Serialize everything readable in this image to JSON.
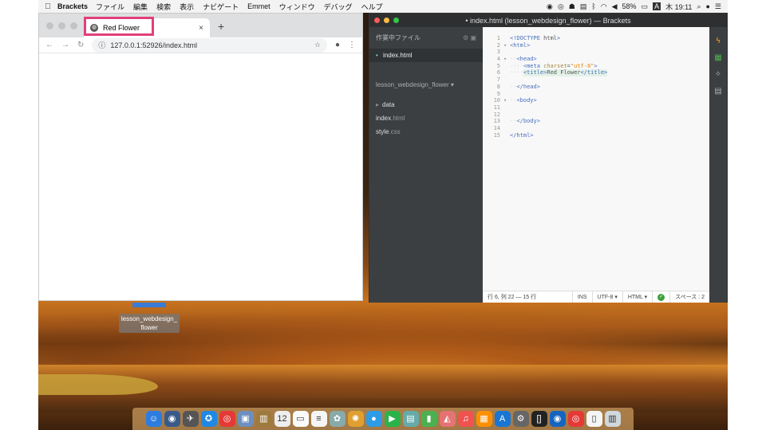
{
  "menubar": {
    "apple": "",
    "app_name": "Brackets",
    "menus": [
      "ファイル",
      "編集",
      "検索",
      "表示",
      "ナビゲート",
      "Emmet",
      "ウィンドウ",
      "デバッグ",
      "ヘルプ"
    ],
    "battery": "58%",
    "clock": "木 19:11"
  },
  "chrome": {
    "tab_title": "Red Flower",
    "url": "127.0.0.1:52926/index.html",
    "new_tab": "+",
    "close_tab": "×"
  },
  "desktop": {
    "folder_label": "lesson_webdesign_\nflower"
  },
  "brackets": {
    "window_title": "• index.html (lesson_webdesign_flower) — Brackets",
    "sidebar": {
      "working_files_label": "作業中ファイル",
      "working_file": "index.html",
      "project_name": "lesson_webdesign_flower ▾",
      "tree": {
        "folder": "data",
        "file1_name": "index",
        "file1_ext": ".html",
        "file2_name": "style",
        "file2_ext": ".css"
      }
    },
    "code_lines": [
      {
        "n": "1",
        "text": "<!DOCTYPE html>"
      },
      {
        "n": "2",
        "text": "<html>"
      },
      {
        "n": "3",
        "text": ""
      },
      {
        "n": "4",
        "text": "<head>"
      },
      {
        "n": "5",
        "text": "<meta charset=\"utf-8\">"
      },
      {
        "n": "6",
        "text": "<title>Red Flower</title>"
      },
      {
        "n": "7",
        "text": ""
      },
      {
        "n": "8",
        "text": "</head>"
      },
      {
        "n": "9",
        "text": ""
      },
      {
        "n": "10",
        "text": "<body>"
      },
      {
        "n": "11",
        "text": ""
      },
      {
        "n": "12",
        "text": ""
      },
      {
        "n": "13",
        "text": "</body>"
      },
      {
        "n": "14",
        "text": ""
      },
      {
        "n": "15",
        "text": "</html>"
      }
    ],
    "status": {
      "cursor": "行 6, 列 22 — 15 行",
      "mode": "INS",
      "encoding": "UTF-8 ▾",
      "language": "HTML ▾",
      "spaces": "スペース : 2"
    }
  }
}
